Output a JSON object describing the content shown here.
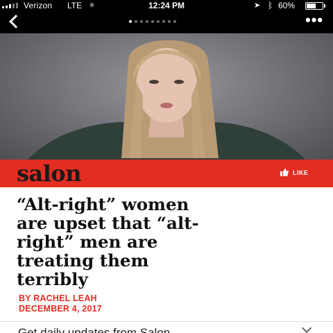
{
  "status_bar": {
    "carrier": "Verizon",
    "network": "LTE",
    "time": "12:24 PM",
    "battery_percent": "60%",
    "battery_level": 0.6,
    "signal_bars": 3
  },
  "nav": {
    "page_dots_total": 9,
    "page_dots_active": 0,
    "more_label": "•••"
  },
  "hero": {
    "image_name": "article-hero-photo"
  },
  "brand": {
    "logo_text": "salon",
    "like_label": "LIKE",
    "accent_color": "#e32d22"
  },
  "article": {
    "headline_lines": [
      "“Alt-right” women",
      "are upset that “alt-",
      "right” men are",
      "treating them",
      "terribly"
    ],
    "byline": "BY RACHEL LEAH",
    "date": "DECEMBER 4, 2017"
  },
  "promo": {
    "text": "Get daily updates from Salon"
  }
}
